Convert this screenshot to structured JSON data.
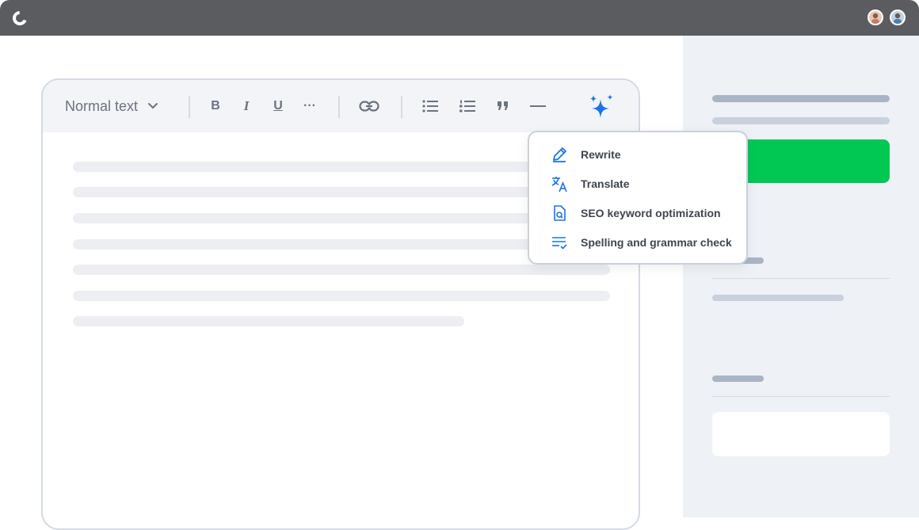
{
  "window": {
    "avatars": [
      "user-avatar-1",
      "user-avatar-2"
    ]
  },
  "toolbar": {
    "text_style": "Normal text",
    "bold_label": "B",
    "italic_label": "I",
    "underline_label": "U",
    "more_label": "···"
  },
  "ai_menu": {
    "items": [
      {
        "label": "Rewrite",
        "icon": "pencil-icon"
      },
      {
        "label": "Translate",
        "icon": "translate-icon"
      },
      {
        "label": "SEO keyword optimization",
        "icon": "seo-document-icon"
      },
      {
        "label": "Spelling and grammar check",
        "icon": "spellcheck-icon"
      }
    ]
  },
  "colors": {
    "accent_blue": "#1a73e8",
    "cta_green": "#00c853",
    "titlebar": "#5a5c60",
    "panel_bg": "#eef1f5"
  }
}
